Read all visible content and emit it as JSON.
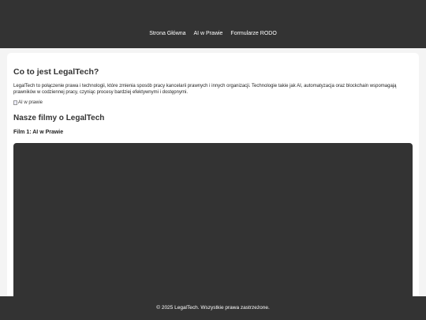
{
  "nav": {
    "items": [
      {
        "label": "Strona Główna"
      },
      {
        "label": "AI w Prawie"
      },
      {
        "label": "Formularze RODO"
      }
    ]
  },
  "main": {
    "title": "Co to jest LegalTech?",
    "intro": "LegalTech to połączenie prawa i technologii, które zmienia sposób pracy kancelarii prawnych i innych organizacji. Technologie takie jak AI, automatyzacja oraz blockchain wspomagają prawników w codziennej pracy, czyniąc procesy bardziej efektywnymi i dostępnymi.",
    "image_alt": "AI w prawie",
    "films_heading": "Nasze filmy o LegalTech",
    "film1_title": "Film 1: AI w Prawie"
  },
  "footer": {
    "text": "© 2025 LegalTech. Wszystkie prawa zastrzeżone."
  }
}
